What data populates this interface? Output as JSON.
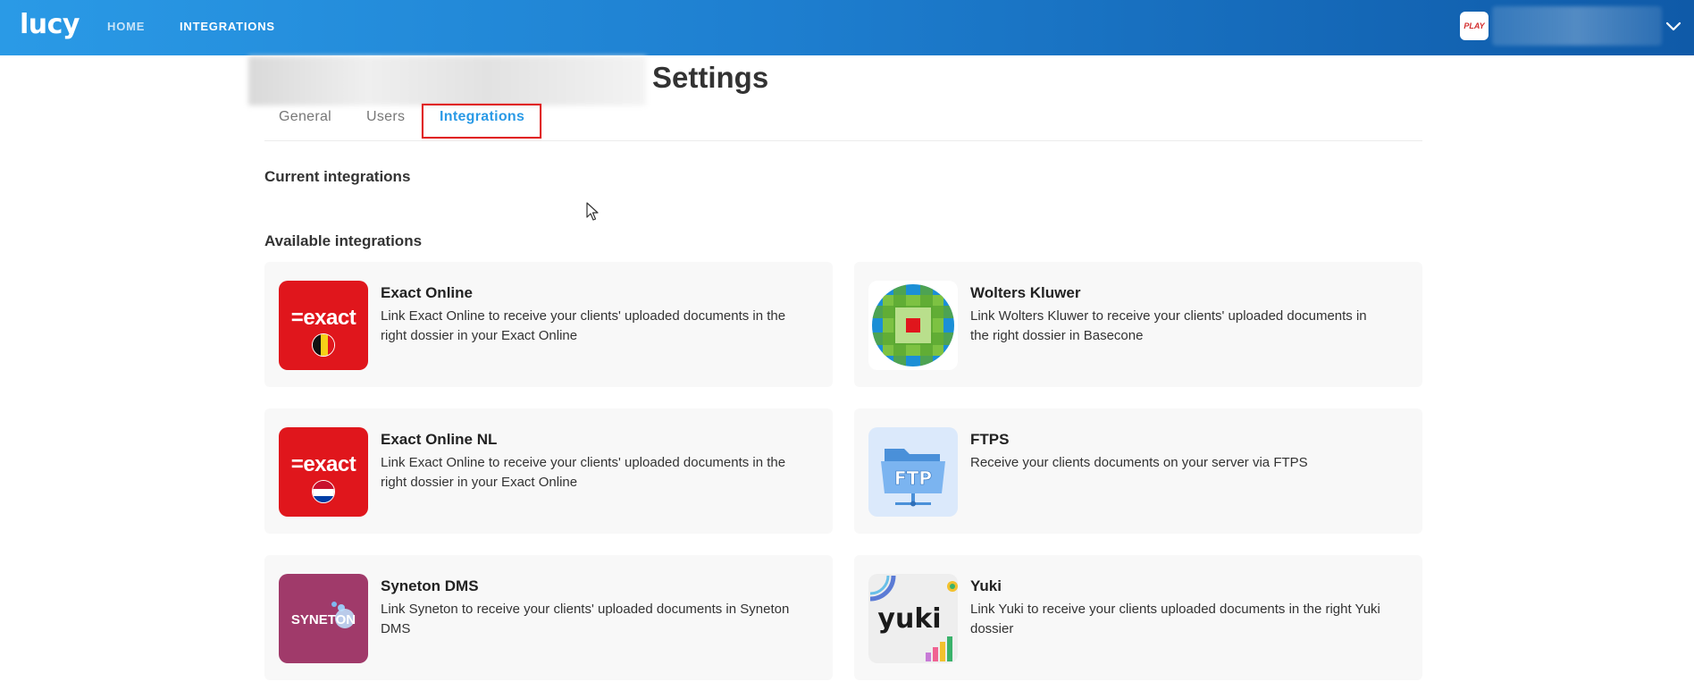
{
  "header": {
    "logo": "lucy",
    "nav": [
      {
        "label": "HOME"
      },
      {
        "label": "INTEGRATIONS"
      }
    ],
    "account_logo_text": "PLAY"
  },
  "page": {
    "title": "Settings",
    "tabs": [
      {
        "label": "General"
      },
      {
        "label": "Users"
      },
      {
        "label": "Integrations",
        "active": true
      }
    ]
  },
  "sections": {
    "current": "Current integrations",
    "available": "Available integrations"
  },
  "integrations": [
    {
      "name": "Exact Online",
      "description": "Link Exact Online to receive your clients' uploaded documents in the right dossier in your Exact Online",
      "logo_text": "=exact",
      "icon": "exact-online-belgium-logo"
    },
    {
      "name": "Wolters Kluwer",
      "description": "Link Wolters Kluwer to receive your clients' uploaded documents in the right dossier in Basecone",
      "icon": "wolters-kluwer-logo"
    },
    {
      "name": "Exact Online NL",
      "description": "Link Exact Online to receive your clients' uploaded documents in the right dossier in your Exact Online",
      "logo_text": "=exact",
      "icon": "exact-online-nl-logo"
    },
    {
      "name": "FTPS",
      "description": "Receive your clients documents on your server via FTPS",
      "logo_text": "FTP",
      "icon": "ftp-folder-logo"
    },
    {
      "name": "Syneton DMS",
      "description": "Link Syneton to receive your clients' uploaded documents in Syneton DMS",
      "logo_text": "SYNETON",
      "icon": "syneton-logo"
    },
    {
      "name": "Yuki",
      "description": "Link Yuki to receive your clients uploaded documents in the right Yuki dossier",
      "logo_text": "yuki",
      "icon": "yuki-logo"
    }
  ],
  "colors": {
    "header_start": "#2a9ae6",
    "header_end": "#0f5aa8",
    "active_tab": "#2a9ae6",
    "highlight": "#e02424",
    "exact_red": "#e0161c"
  }
}
